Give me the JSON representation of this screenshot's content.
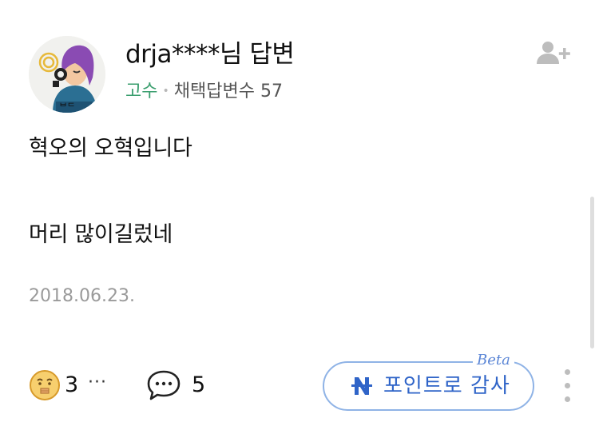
{
  "answer": {
    "author": "drja****님 답변",
    "grade": "고수",
    "adopted_label": "채택답변수",
    "adopted_count": "57",
    "body_lines": [
      "혁오의 오혁입니다",
      "머리 많이길렀네"
    ],
    "date": "2018.06.23."
  },
  "actions": {
    "reaction_count": "3",
    "more_inline": "···",
    "comment_count": "5",
    "thanks_label": "포인트로 감사",
    "beta_label": "Beta",
    "reaction_icon": "thinking-face-icon",
    "comment_icon": "speech-bubble-icon",
    "thanks_icon": "naver-n-icon",
    "add_friend_icon": "add-friend-icon",
    "more_icon": "vertical-dots-icon"
  },
  "colors": {
    "grade": "#3a9e6e",
    "point_button": "#2f64c8",
    "point_border": "#8fb3e6",
    "date": "#9a9a9a"
  }
}
